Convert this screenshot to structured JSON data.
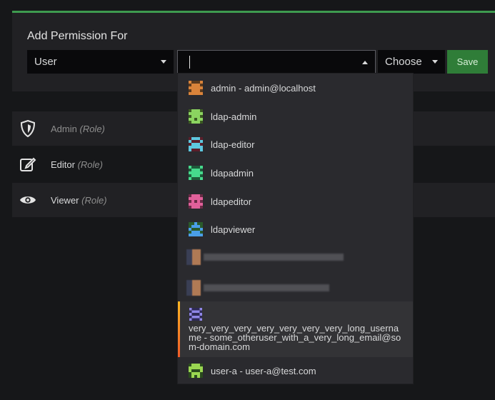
{
  "panel": {
    "title": "Add Permission For",
    "type_select": {
      "value": "User"
    },
    "user_select": {
      "value": ""
    },
    "permission_select": {
      "value": "Choose"
    },
    "save_label": "Save",
    "accent_color": "#3e9b4f"
  },
  "roles": [
    {
      "name": "Admin",
      "tag": "(Role)",
      "icon": "shield-icon"
    },
    {
      "name": "Editor",
      "tag": "(Role)",
      "icon": "edit-icon"
    },
    {
      "name": "Viewer",
      "tag": "(Role)",
      "icon": "eye-icon"
    }
  ],
  "dropdown": {
    "options": [
      {
        "label": "admin - admin@localhost",
        "avatar_color": "#d9833a"
      },
      {
        "label": "ldap-admin",
        "avatar_color": "#8bd460"
      },
      {
        "label": "ldap-editor",
        "avatar_color": "#5ec8e0"
      },
      {
        "label": "ldapadmin",
        "avatar_color": "#46d98c"
      },
      {
        "label": "ldapeditor",
        "avatar_color": "#e0609a"
      },
      {
        "label": "ldapviewer",
        "avatar_color": "#4a9ee8"
      },
      {
        "label": "very_very_very_very_very_very_very_long_username - some_otheruser_with_a_very_long_email@som-domain.com",
        "avatar_color": "#8f86e6"
      },
      {
        "label": "user-a - user-a@test.com",
        "avatar_color": "#9ad651"
      }
    ]
  }
}
